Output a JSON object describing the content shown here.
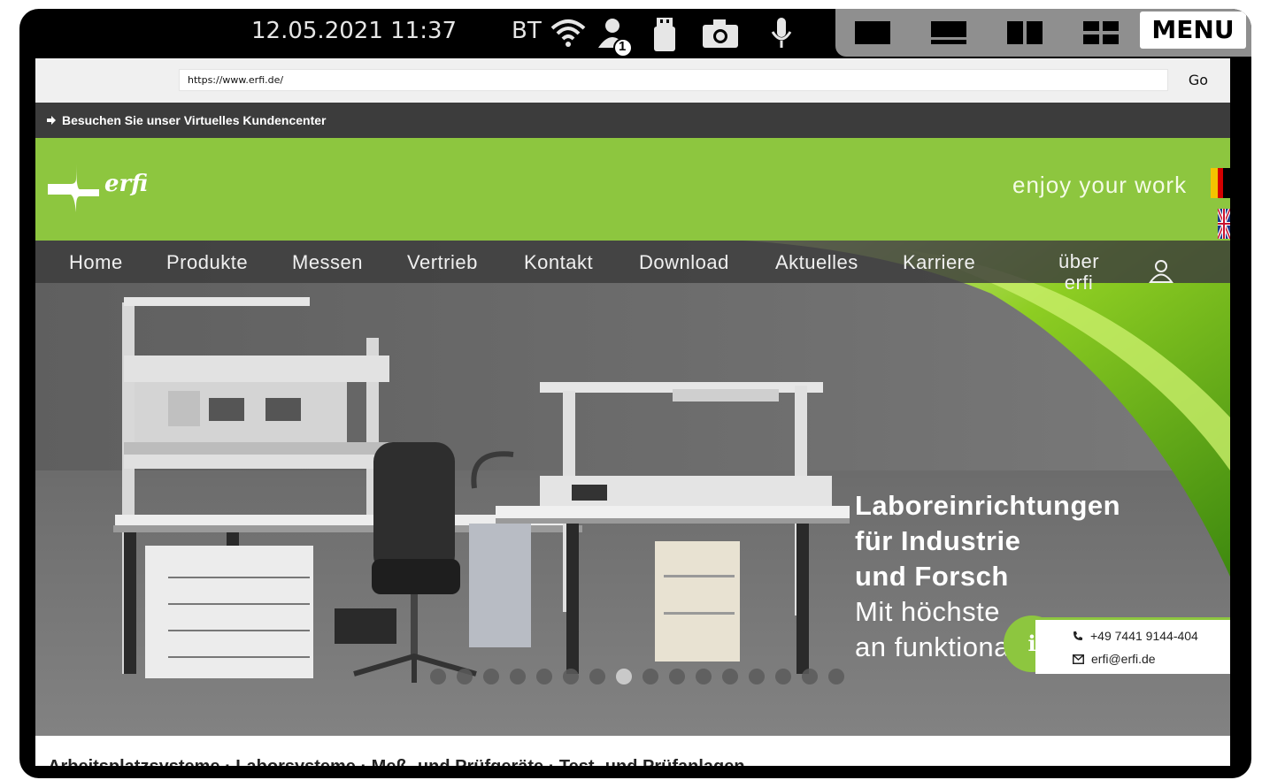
{
  "status_bar": {
    "datetime": "12.05.2021 11:37",
    "bt_label": "BT",
    "user_badge": "1",
    "menu_label": "MENU"
  },
  "browser": {
    "url": "https://www.erfi.de/",
    "go_label": "Go"
  },
  "site": {
    "topbar_link": "Besuchen Sie unser Virtuelles Kundencenter",
    "logo_text": "erfi",
    "slogan": "enjoy your work",
    "nav": [
      "Home",
      "Produkte",
      "Messen",
      "Vertrieb",
      "Kontakt",
      "Download",
      "Aktuelles",
      "Karriere"
    ],
    "nav_about_1": "über",
    "nav_about_2": "erfi",
    "hero_line1": "Laboreinrichtungen",
    "hero_line2": "für Industrie",
    "hero_line3": "und Forsch",
    "hero_line4": "Mit höchste",
    "hero_line5": "an funktionales Design",
    "contact_phone": "+49 7441 9144-404",
    "contact_email": "erfi@erfi.de",
    "info_glyph": "i",
    "footer_text": "Arbeitsplatzsysteme · Laborsysteme · Meß- und Prüfgeräte · Test- und Prüfanlagen",
    "slider_total": 16,
    "slider_active_index": 7
  },
  "colors": {
    "brand_green": "#8dc63f",
    "nav_bg": "#3c3c3c"
  }
}
